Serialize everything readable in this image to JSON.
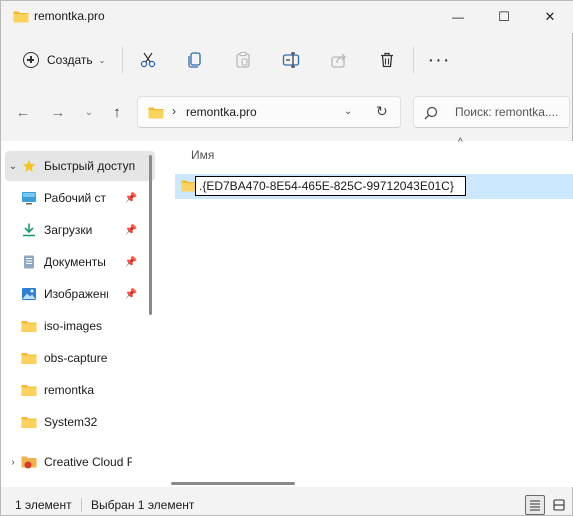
{
  "window": {
    "title": "remontka.pro",
    "controls": {
      "minimize": "—",
      "maximize": "☐",
      "close": "✕"
    }
  },
  "commandbar": {
    "create_label": "Создать",
    "icons": [
      "cut-icon",
      "copy-icon",
      "paste-icon",
      "rename-icon",
      "share-icon",
      "delete-icon"
    ],
    "more_label": "···"
  },
  "navigation": {
    "address_path": "remontka.pro",
    "search_placeholder": "Поиск: remontka...."
  },
  "sidebar": {
    "items": [
      {
        "label": "Быстрый доступ",
        "icon": "star-icon",
        "pinned": false,
        "selected": true
      },
      {
        "label": "Рабочий стол",
        "icon": "desktop-icon",
        "pinned": true
      },
      {
        "label": "Загрузки",
        "icon": "download-icon",
        "pinned": true
      },
      {
        "label": "Документы",
        "icon": "documents-icon",
        "pinned": true
      },
      {
        "label": "Изображения",
        "icon": "pictures-icon",
        "pinned": true
      },
      {
        "label": "iso-images",
        "icon": "folder-icon",
        "pinned": false
      },
      {
        "label": "obs-capture",
        "icon": "folder-icon",
        "pinned": false
      },
      {
        "label": "remontka",
        "icon": "folder-icon",
        "pinned": false
      },
      {
        "label": "System32",
        "icon": "folder-icon",
        "pinned": false
      },
      {
        "label": "Creative Cloud Files",
        "icon": "creative-cloud-icon",
        "pinned": false
      }
    ]
  },
  "files": {
    "column_name": "Имя",
    "rename_value": ".{ED7BA470-8E54-465E-825C-99712043E01C}"
  },
  "status": {
    "count": "1 элемент",
    "selected": "Выбран 1 элемент"
  },
  "colors": {
    "selection": "#cce8ff",
    "folder": "#f8c94d",
    "accent": "#0067c0"
  }
}
